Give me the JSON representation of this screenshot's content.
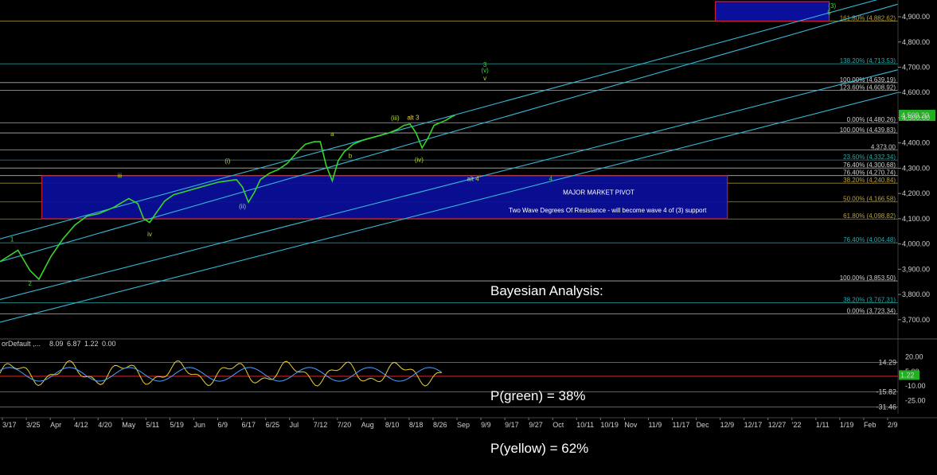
{
  "chart_data": [
    {
      "type": "line",
      "title": "",
      "ylim": [
        3630,
        4960
      ],
      "y_ticks": [
        "4,900.00",
        "4,800.00",
        "4,700.00",
        "4,600.00",
        "4,500.00",
        "4,400.00",
        "4,300.00",
        "4,200.00",
        "4,100.00",
        "4,000.00",
        "3,900.00",
        "3,800.00",
        "3,700.00"
      ],
      "x_ticks": [
        "3/17",
        "3/25",
        "Apr",
        "4/12",
        "4/20",
        "May",
        "5/11",
        "5/19",
        "Jun",
        "6/9",
        "6/17",
        "6/25",
        "Jul",
        "7/12",
        "7/20",
        "Aug",
        "8/10",
        "8/18",
        "8/26",
        "Sep",
        "9/9",
        "9/17",
        "9/27",
        "Oct",
        "10/11",
        "10/19",
        "Nov",
        "11/9",
        "11/17",
        "Dec",
        "12/9",
        "12/17",
        "12/27",
        "'22",
        "1/11",
        "1/19",
        "Feb",
        "2/9"
      ],
      "last_price": "4,509.20",
      "series_points": [
        [
          0,
          3930
        ],
        [
          6,
          3975
        ],
        [
          10,
          3895
        ],
        [
          13,
          3860
        ],
        [
          17,
          3950
        ],
        [
          21,
          4020
        ],
        [
          25,
          4075
        ],
        [
          29,
          4110
        ],
        [
          33,
          4120
        ],
        [
          38,
          4145
        ],
        [
          43,
          4180
        ],
        [
          46,
          4160
        ],
        [
          48,
          4100
        ],
        [
          50,
          4085
        ],
        [
          52,
          4120
        ],
        [
          55,
          4170
        ],
        [
          58,
          4195
        ],
        [
          61,
          4205
        ],
        [
          64,
          4215
        ],
        [
          67,
          4225
        ],
        [
          70,
          4235
        ],
        [
          73,
          4245
        ],
        [
          76,
          4250
        ],
        [
          79,
          4255
        ],
        [
          81,
          4225
        ],
        [
          83,
          4165
        ],
        [
          85,
          4205
        ],
        [
          87,
          4255
        ],
        [
          90,
          4280
        ],
        [
          93,
          4295
        ],
        [
          96,
          4320
        ],
        [
          99,
          4360
        ],
        [
          102,
          4395
        ],
        [
          105,
          4405
        ],
        [
          107,
          4405
        ],
        [
          109,
          4310
        ],
        [
          111,
          4250
        ],
        [
          113,
          4330
        ],
        [
          115,
          4365
        ],
        [
          118,
          4395
        ],
        [
          121,
          4410
        ],
        [
          124,
          4420
        ],
        [
          127,
          4430
        ],
        [
          130,
          4440
        ],
        [
          133,
          4455
        ],
        [
          135,
          4470
        ],
        [
          137,
          4475
        ],
        [
          139,
          4440
        ],
        [
          141,
          4380
        ],
        [
          143,
          4420
        ],
        [
          145,
          4470
        ],
        [
          147,
          4480
        ],
        [
          149,
          4490
        ],
        [
          151,
          4505
        ],
        [
          152,
          4509.2
        ]
      ],
      "fib_levels": [
        {
          "label": "161.80% (4,882.62)",
          "value": 4882.62,
          "color": "#b8a23a"
        },
        {
          "label": "138.20% (4,713.53)",
          "value": 4713.53,
          "color": "#2aa7a7"
        },
        {
          "label": "100.00% (4,639.19)",
          "value": 4639.19,
          "color": "#cfcfcf"
        },
        {
          "label": "123.60% (4,608.92)",
          "value": 4608.92,
          "color": "#cfcfcf"
        },
        {
          "label": "0.00% (4,480.26)",
          "value": 4480.26,
          "color": "#cfcfcf"
        },
        {
          "label": "100.00% (4,439.83)",
          "value": 4439.83,
          "color": "#cfcfcf"
        },
        {
          "label": "4,373.00",
          "value": 4373.0,
          "color": "#cfcfcf"
        },
        {
          "label": "23.60% (4,332.34)",
          "value": 4332.34,
          "color": "#2aa7a7"
        },
        {
          "label": "76.40% (4,300.68)",
          "value": 4300.68,
          "color": "#cfcfcf"
        },
        {
          "label": "76.40% (4,270.74)",
          "value": 4270.74,
          "color": "#cfcfcf"
        },
        {
          "label": "38.20% (4,240.84)",
          "value": 4240.84,
          "color": "#b8a23a"
        },
        {
          "label": "50.00% (4,166.58)",
          "value": 4166.58,
          "color": "#b8a23a"
        },
        {
          "label": "61.80% (4,098.82)",
          "value": 4098.82,
          "color": "#b8a23a"
        },
        {
          "label": "76.40% (4,004.48)",
          "value": 4004.48,
          "color": "#2aa7a7"
        },
        {
          "label": "100.00% (3,853.50)",
          "value": 3853.5,
          "color": "#cfcfcf"
        },
        {
          "label": "38.20% (3,767.31)",
          "value": 3767.31,
          "color": "#2aa7a7"
        },
        {
          "label": "0.00% (3,723.34)",
          "value": 3723.34,
          "color": "#cfcfcf"
        }
      ],
      "wave_labels": [
        {
          "text": "1",
          "x_index": 4,
          "value": 4010,
          "color": "#3fd43f"
        },
        {
          "text": "2",
          "x_index": 10,
          "value": 3835,
          "color": "#3fd43f"
        },
        {
          "text": "iii",
          "x_index": 40,
          "value": 4262,
          "color": "#b5d53a"
        },
        {
          "text": "iv",
          "x_index": 50,
          "value": 4030,
          "color": "#b5d53a"
        },
        {
          "text": "(i)",
          "x_index": 76,
          "value": 4320,
          "color": "#b5d53a"
        },
        {
          "text": "(ii)",
          "x_index": 81,
          "value": 4140,
          "color": "#b5d53a"
        },
        {
          "text": "(iii)",
          "x_index": 132,
          "value": 4490,
          "color": "#b5d53a"
        },
        {
          "text": "a",
          "x_index": 111,
          "value": 4428,
          "color": "#b5d53a"
        },
        {
          "text": "b",
          "x_index": 117,
          "value": 4340,
          "color": "#b5d53a"
        },
        {
          "text": "(iv)",
          "x_index": 140,
          "value": 4325,
          "color": "#b5d53a"
        },
        {
          "text": "alt 3",
          "x_index": 138,
          "value": 4492,
          "color": "#e2d04a"
        },
        {
          "text": "alt 4",
          "x_index": 158,
          "value": 4250,
          "color": "#e2d04a"
        },
        {
          "text": "4",
          "x_index": 184,
          "value": 4250,
          "color": "#3fd43f"
        },
        {
          "text": "3",
          "x_index": 162,
          "value": 4702,
          "color": "#3fd43f"
        },
        {
          "text": "(v)",
          "x_index": 162,
          "value": 4680,
          "color": "#3fd43f"
        },
        {
          "text": "v",
          "x_index": 162,
          "value": 4648,
          "color": "#b5d53a"
        },
        {
          "text": "(3)",
          "x_index": 278,
          "value": 4935,
          "color": "#3fd43f"
        },
        {
          "text": "5",
          "x_index": 277,
          "value": 4908,
          "color": "#3fd43f"
        }
      ],
      "pivot_zone": {
        "title": "MAJOR MARKET PIVOT",
        "subtitle": "Two Wave Degrees Of Resistance - will become wave 4 of (3) support",
        "low": 4100,
        "high": 4270
      },
      "target_box": {
        "low": 4882.62,
        "high": 4960
      }
    },
    {
      "type": "line",
      "title": "",
      "header_label": "orDefault ,...",
      "header_values": [
        {
          "text": "8.09",
          "color": "#e8d13a"
        },
        {
          "text": "6.87",
          "color": "#4aa3ff"
        },
        {
          "text": "1.22",
          "color": "#7de07d"
        },
        {
          "text": "0.00",
          "color": "#3fb34f"
        }
      ],
      "ylim": [
        -35,
        30
      ],
      "y_ticks": [
        "20.00",
        "5.00",
        "-10.00",
        "-25.00"
      ],
      "right_labels": [
        {
          "text": "14.29",
          "value": 14.29
        },
        {
          "text": "-15.82",
          "value": -15.82
        },
        {
          "text": "-31.46",
          "value": -31.46
        }
      ],
      "last_value": "1.22"
    }
  ],
  "analysis": {
    "title": "Bayesian Analysis:",
    "lines": [
      "P(green) = 38%",
      "P(yellow) = 62%"
    ]
  }
}
